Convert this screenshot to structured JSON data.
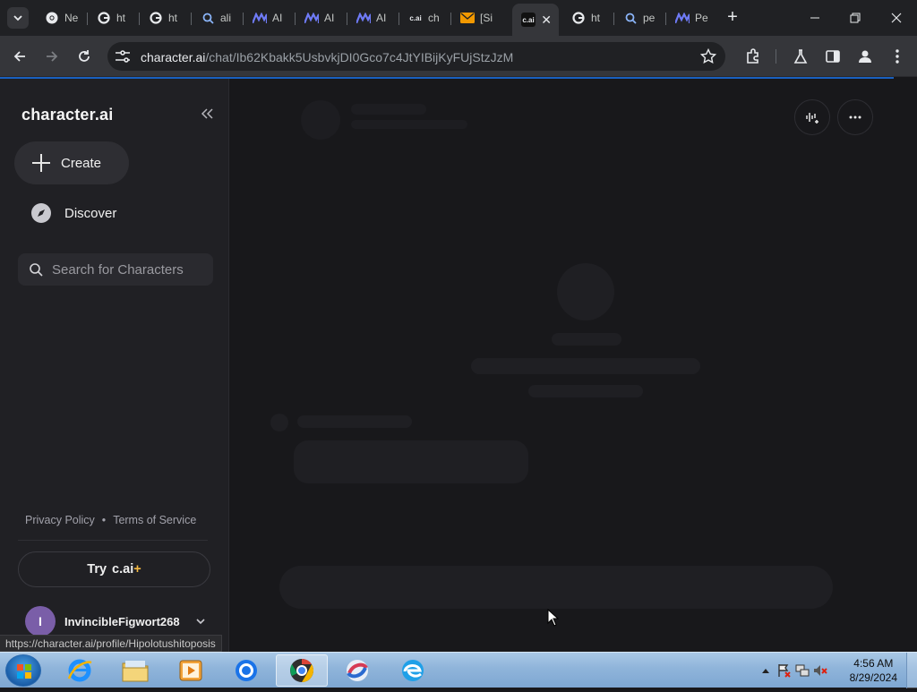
{
  "browser": {
    "tabs": [
      {
        "label": "Ne",
        "icon": "chrome-icon"
      },
      {
        "label": "ht",
        "icon": "google-icon"
      },
      {
        "label": "ht",
        "icon": "google-icon"
      },
      {
        "label": "ali",
        "icon": "search-icon"
      },
      {
        "label": "AI",
        "icon": "dual-m-logo-icon"
      },
      {
        "label": "AI",
        "icon": "dual-m-logo-icon"
      },
      {
        "label": "AI",
        "icon": "dual-m-logo-icon"
      },
      {
        "label": "ch",
        "icon": "cai-icon"
      },
      {
        "label": "[Si",
        "icon": "mail-icon"
      },
      {
        "label": "",
        "icon": "cai-icon",
        "active": true
      },
      {
        "label": "ht",
        "icon": "google-icon"
      },
      {
        "label": "pe",
        "icon": "search-icon"
      },
      {
        "label": "Pe",
        "icon": "dual-m-logo-icon"
      }
    ],
    "tab_favicon_text": "c.ai",
    "url_host": "character.ai",
    "url_path": "/chat/Ib62Kbakk5UsbvkjDI0Gco7c4JtYIBijKyFUjStzJzM",
    "status_url": "https://character.ai/profile/Hipolotushitoposis"
  },
  "sidebar": {
    "logo": "character.ai",
    "create_label": "Create",
    "discover_label": "Discover",
    "search_placeholder": "Search for Characters",
    "privacy_label": "Privacy Policy",
    "separator": "•",
    "terms_label": "Terms of Service",
    "try_label": "Try",
    "try_brand": "c.ai",
    "try_plus": "+",
    "user_initial": "I",
    "username": "InvincibleFigwort268"
  },
  "taskbar": {
    "time": "4:56 AM",
    "date": "8/29/2024",
    "apps": [
      "internet-explorer-icon",
      "file-explorer-icon",
      "media-player-icon",
      "chrome-icon",
      "chrome-canary-icon",
      "app-swirl-icon",
      "edge-icon"
    ]
  },
  "colors": {
    "accent": "#1a73e8",
    "plus_accent": "#f5b942",
    "avatar": "#7a5ea8"
  }
}
